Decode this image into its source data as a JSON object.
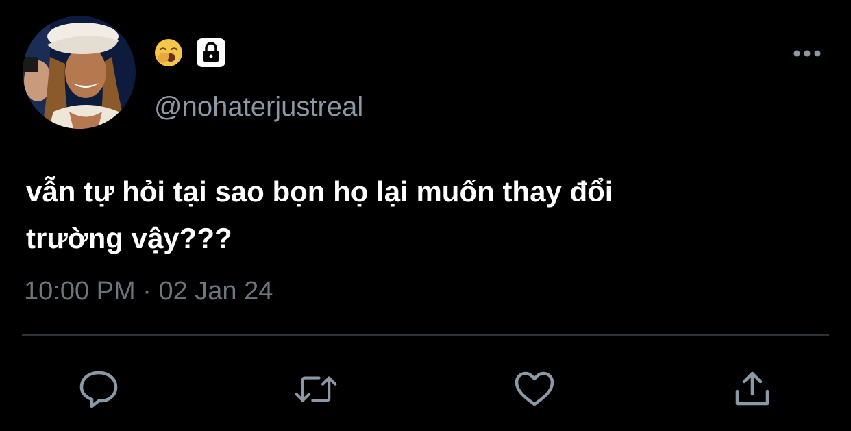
{
  "tweet": {
    "avatar": {
      "icon": "profile-photo"
    },
    "display_name_icons": [
      "yawning-face-emoji-icon",
      "lock-icon"
    ],
    "handle": "@nohaterjustreal",
    "text_line_1": "vẫn tự hỏi tại sao bọn họ lại muốn thay đổi",
    "text_line_2": "trường vậy???",
    "time": "10:00 PM",
    "separator": "·",
    "date": "02 Jan 24"
  },
  "actions": [
    {
      "name": "reply",
      "icon": "reply-icon"
    },
    {
      "name": "retweet",
      "icon": "retweet-icon"
    },
    {
      "name": "like",
      "icon": "heart-icon"
    },
    {
      "name": "share",
      "icon": "share-icon"
    }
  ],
  "colors": {
    "background": "#000000",
    "text": "#ffffff",
    "handle": "#8b98a5",
    "meta": "#6e767d",
    "icons": "#8b98a5",
    "divider": "#2f3336"
  }
}
